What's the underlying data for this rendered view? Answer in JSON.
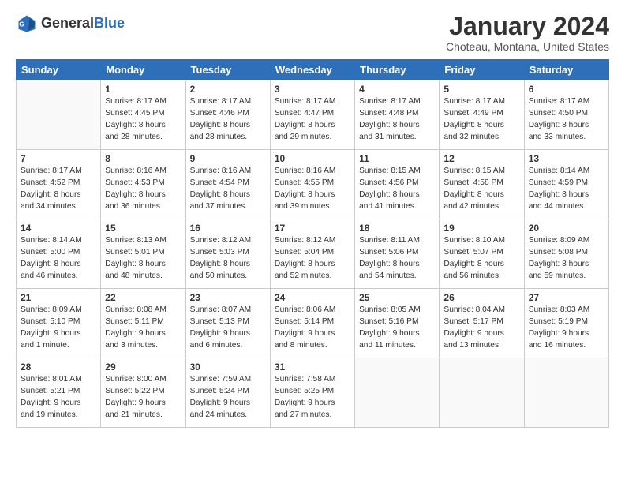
{
  "header": {
    "logo_general": "General",
    "logo_blue": "Blue",
    "month": "January 2024",
    "location": "Choteau, Montana, United States"
  },
  "days_of_week": [
    "Sunday",
    "Monday",
    "Tuesday",
    "Wednesday",
    "Thursday",
    "Friday",
    "Saturday"
  ],
  "weeks": [
    [
      {
        "day": null,
        "info": null
      },
      {
        "day": "1",
        "info": "Sunrise: 8:17 AM\nSunset: 4:45 PM\nDaylight: 8 hours\nand 28 minutes."
      },
      {
        "day": "2",
        "info": "Sunrise: 8:17 AM\nSunset: 4:46 PM\nDaylight: 8 hours\nand 28 minutes."
      },
      {
        "day": "3",
        "info": "Sunrise: 8:17 AM\nSunset: 4:47 PM\nDaylight: 8 hours\nand 29 minutes."
      },
      {
        "day": "4",
        "info": "Sunrise: 8:17 AM\nSunset: 4:48 PM\nDaylight: 8 hours\nand 31 minutes."
      },
      {
        "day": "5",
        "info": "Sunrise: 8:17 AM\nSunset: 4:49 PM\nDaylight: 8 hours\nand 32 minutes."
      },
      {
        "day": "6",
        "info": "Sunrise: 8:17 AM\nSunset: 4:50 PM\nDaylight: 8 hours\nand 33 minutes."
      }
    ],
    [
      {
        "day": "7",
        "info": "Sunrise: 8:17 AM\nSunset: 4:52 PM\nDaylight: 8 hours\nand 34 minutes."
      },
      {
        "day": "8",
        "info": "Sunrise: 8:16 AM\nSunset: 4:53 PM\nDaylight: 8 hours\nand 36 minutes."
      },
      {
        "day": "9",
        "info": "Sunrise: 8:16 AM\nSunset: 4:54 PM\nDaylight: 8 hours\nand 37 minutes."
      },
      {
        "day": "10",
        "info": "Sunrise: 8:16 AM\nSunset: 4:55 PM\nDaylight: 8 hours\nand 39 minutes."
      },
      {
        "day": "11",
        "info": "Sunrise: 8:15 AM\nSunset: 4:56 PM\nDaylight: 8 hours\nand 41 minutes."
      },
      {
        "day": "12",
        "info": "Sunrise: 8:15 AM\nSunset: 4:58 PM\nDaylight: 8 hours\nand 42 minutes."
      },
      {
        "day": "13",
        "info": "Sunrise: 8:14 AM\nSunset: 4:59 PM\nDaylight: 8 hours\nand 44 minutes."
      }
    ],
    [
      {
        "day": "14",
        "info": "Sunrise: 8:14 AM\nSunset: 5:00 PM\nDaylight: 8 hours\nand 46 minutes."
      },
      {
        "day": "15",
        "info": "Sunrise: 8:13 AM\nSunset: 5:01 PM\nDaylight: 8 hours\nand 48 minutes."
      },
      {
        "day": "16",
        "info": "Sunrise: 8:12 AM\nSunset: 5:03 PM\nDaylight: 8 hours\nand 50 minutes."
      },
      {
        "day": "17",
        "info": "Sunrise: 8:12 AM\nSunset: 5:04 PM\nDaylight: 8 hours\nand 52 minutes."
      },
      {
        "day": "18",
        "info": "Sunrise: 8:11 AM\nSunset: 5:06 PM\nDaylight: 8 hours\nand 54 minutes."
      },
      {
        "day": "19",
        "info": "Sunrise: 8:10 AM\nSunset: 5:07 PM\nDaylight: 8 hours\nand 56 minutes."
      },
      {
        "day": "20",
        "info": "Sunrise: 8:09 AM\nSunset: 5:08 PM\nDaylight: 8 hours\nand 59 minutes."
      }
    ],
    [
      {
        "day": "21",
        "info": "Sunrise: 8:09 AM\nSunset: 5:10 PM\nDaylight: 9 hours\nand 1 minute."
      },
      {
        "day": "22",
        "info": "Sunrise: 8:08 AM\nSunset: 5:11 PM\nDaylight: 9 hours\nand 3 minutes."
      },
      {
        "day": "23",
        "info": "Sunrise: 8:07 AM\nSunset: 5:13 PM\nDaylight: 9 hours\nand 6 minutes."
      },
      {
        "day": "24",
        "info": "Sunrise: 8:06 AM\nSunset: 5:14 PM\nDaylight: 9 hours\nand 8 minutes."
      },
      {
        "day": "25",
        "info": "Sunrise: 8:05 AM\nSunset: 5:16 PM\nDaylight: 9 hours\nand 11 minutes."
      },
      {
        "day": "26",
        "info": "Sunrise: 8:04 AM\nSunset: 5:17 PM\nDaylight: 9 hours\nand 13 minutes."
      },
      {
        "day": "27",
        "info": "Sunrise: 8:03 AM\nSunset: 5:19 PM\nDaylight: 9 hours\nand 16 minutes."
      }
    ],
    [
      {
        "day": "28",
        "info": "Sunrise: 8:01 AM\nSunset: 5:21 PM\nDaylight: 9 hours\nand 19 minutes."
      },
      {
        "day": "29",
        "info": "Sunrise: 8:00 AM\nSunset: 5:22 PM\nDaylight: 9 hours\nand 21 minutes."
      },
      {
        "day": "30",
        "info": "Sunrise: 7:59 AM\nSunset: 5:24 PM\nDaylight: 9 hours\nand 24 minutes."
      },
      {
        "day": "31",
        "info": "Sunrise: 7:58 AM\nSunset: 5:25 PM\nDaylight: 9 hours\nand 27 minutes."
      },
      {
        "day": null,
        "info": null
      },
      {
        "day": null,
        "info": null
      },
      {
        "day": null,
        "info": null
      }
    ]
  ]
}
